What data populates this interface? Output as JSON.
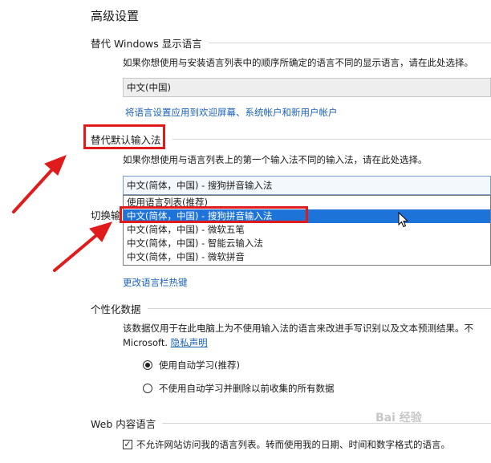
{
  "page": {
    "title": "高级设置"
  },
  "display_language": {
    "heading": "替代 Windows 显示语言",
    "description": "如果你想使用与安装语言列表中的顺序所确定的语言不同的显示语言，请在此处选择。",
    "selected_value": "中文(中国)",
    "apply_link": "将语言设置应用到欢迎屏幕、系统帐户和新用户帐户"
  },
  "input_method": {
    "heading": "替代默认输入法",
    "description": "如果你想使用与语言列表上的第一个输入法不同的输入法，请在此处选择。",
    "selected_value": "中文(简体，中国) - 搜狗拼音输入法",
    "options": [
      "使用语言列表(推荐)",
      "中文(简体，中国) - 搜狗拼音输入法",
      "中文(简体，中国) - 微软五笔",
      "中文(简体，中国) - 智能云输入法",
      "中文(简体，中国) - 微软拼音"
    ],
    "highlighted_index": 1
  },
  "switch_input": {
    "heading": "切换输",
    "hotkey_link": "更改语言栏热键"
  },
  "personalization": {
    "heading": "个性化数据",
    "description_line1": "该数据仅用于在此电脑上为不使用输入法的语言来改进手写识别以及文本预测结果。不",
    "description_line2": "Microsoft.",
    "privacy_link": "隐私声明",
    "option_auto": "使用自动学习(推荐)",
    "option_no_auto": "不使用自动学习并删除以前收集的所有数据"
  },
  "web_language": {
    "heading": "Web 内容语言",
    "checkbox_label": "不允许网站访问我的语言列表。转而使用我的日期、时间和数字格式的语言。"
  },
  "colors": {
    "link": "#1a62b8",
    "highlight": "#1e73d8",
    "annotation_red": "#e01b1b"
  },
  "watermark": "Bai 经验"
}
